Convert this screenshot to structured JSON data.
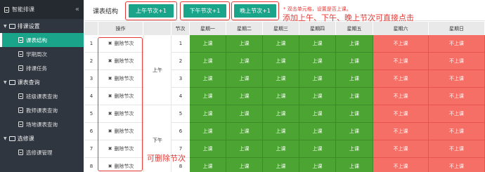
{
  "sidebar": {
    "title": "智能排课",
    "collapse_glyph": "«",
    "groups": [
      {
        "label": "排课设置",
        "items": [
          "课表结构",
          "学期周次",
          "排课任务"
        ]
      },
      {
        "label": "课表查询",
        "items": [
          "班级课表查询",
          "教师课表查询",
          "场地课表查询"
        ]
      },
      {
        "label": "选修课",
        "items": [
          "选修课管理"
        ]
      }
    ],
    "active_item": "课表结构"
  },
  "topbar": {
    "page_label": "课表结构",
    "buttons": [
      "上午节次+1",
      "下午节次+1",
      "晚上节次+1"
    ],
    "hint": "* 双击单元格，设置是否上课。"
  },
  "annotations": {
    "add": "添加上午、下午、晚上节次可直接点击",
    "delete": "可删除节次"
  },
  "table": {
    "headers": [
      "",
      "操作",
      "",
      "节次",
      "星期一",
      "星期二",
      "星期三",
      "星期四",
      "星期五",
      "星期六",
      "星期日"
    ],
    "delete_label": "删除节次",
    "periods": [
      {
        "label": "上午",
        "rows": 4
      },
      {
        "label": "下午",
        "rows": 4
      }
    ],
    "rows": [
      {
        "no": "1",
        "period": "1",
        "cells": [
          "上课",
          "上课",
          "上课",
          "上课",
          "上课",
          "不上课",
          "不上课"
        ]
      },
      {
        "no": "2",
        "period": "2",
        "cells": [
          "上课",
          "上课",
          "上课",
          "上课",
          "上课",
          "不上课",
          "不上课"
        ]
      },
      {
        "no": "3",
        "period": "3",
        "cells": [
          "上课",
          "上课",
          "上课",
          "上课",
          "上课",
          "不上课",
          "不上课"
        ]
      },
      {
        "no": "4",
        "period": "4",
        "cells": [
          "上课",
          "上课",
          "上课",
          "上课",
          "上课",
          "不上课",
          "不上课"
        ]
      },
      {
        "no": "5",
        "period": "5",
        "cells": [
          "上课",
          "上课",
          "上课",
          "上课",
          "上课",
          "不上课",
          "不上课"
        ]
      },
      {
        "no": "6",
        "period": "6",
        "cells": [
          "上课",
          "上课",
          "上课",
          "上课",
          "上课",
          "不上课",
          "不上课"
        ]
      },
      {
        "no": "7",
        "period": "7",
        "cells": [
          "上课",
          "上课",
          "上课",
          "上课",
          "上课",
          "不上课",
          "不上课"
        ]
      },
      {
        "no": "8",
        "period": "8",
        "cells": [
          "上课",
          "上课",
          "上课",
          "上课",
          "上课",
          "不上课",
          "不上课"
        ]
      }
    ],
    "colors": {
      "on": "#4ca433",
      "off": "#f56f66",
      "accent": "#1aa58b",
      "annotation": "#e53935"
    }
  }
}
